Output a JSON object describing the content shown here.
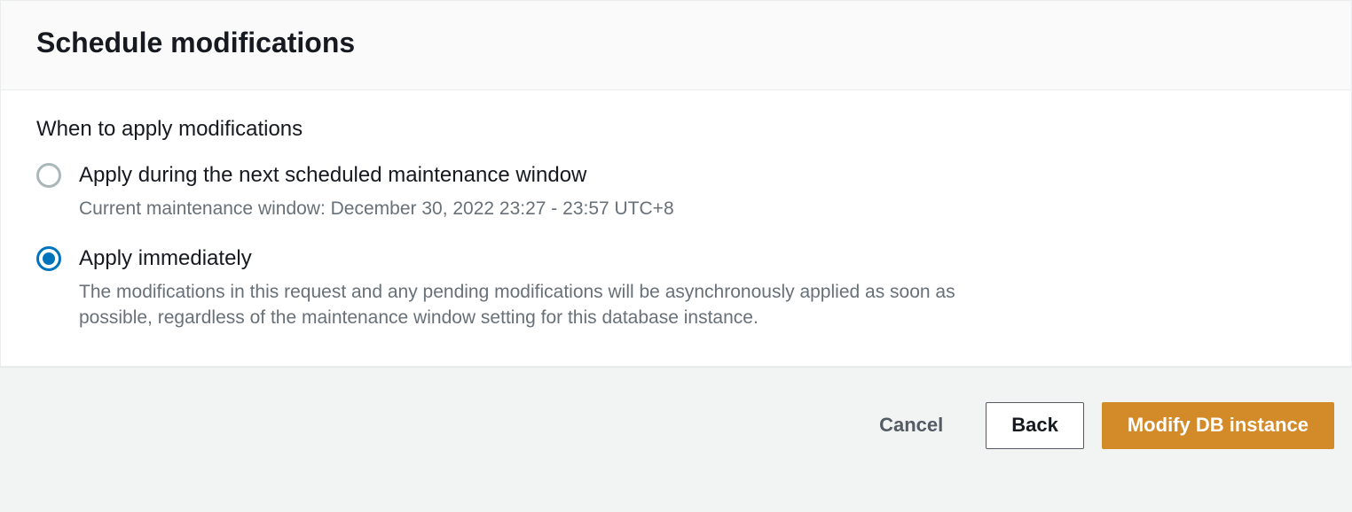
{
  "panel": {
    "title": "Schedule modifications",
    "legend": "When to apply modifications",
    "options": {
      "scheduled": {
        "label": "Apply during the next scheduled maintenance window",
        "desc": "Current maintenance window: December 30, 2022 23:27 - 23:57 UTC+8",
        "selected": false
      },
      "immediate": {
        "label": "Apply immediately",
        "desc": "The modifications in this request and any pending modifications will be asynchronously applied as soon as possible, regardless of the maintenance window setting for this database instance.",
        "selected": true
      }
    }
  },
  "buttons": {
    "cancel": "Cancel",
    "back": "Back",
    "modify": "Modify DB instance"
  }
}
